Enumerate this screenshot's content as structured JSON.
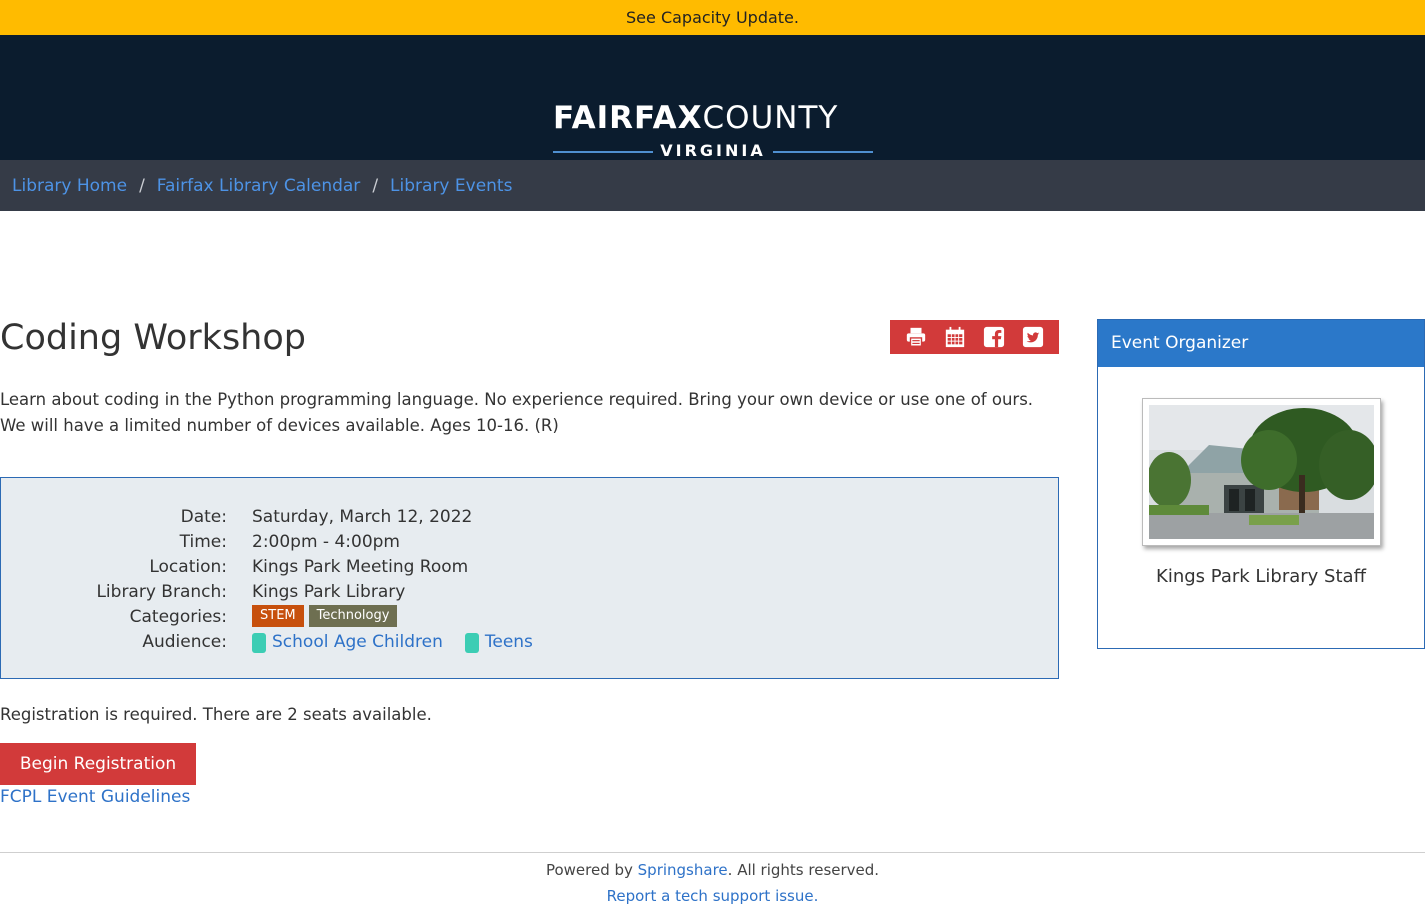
{
  "alert": {
    "text": "See Capacity Update."
  },
  "header": {
    "logo_bold": "FAIRFAX",
    "logo_light": "COUNTY",
    "logo_sub": "VIRGINIA"
  },
  "breadcrumb": {
    "items": [
      "Library Home",
      "Fairfax Library Calendar",
      "Library Events"
    ],
    "separator": "/"
  },
  "event": {
    "title": "Coding Workshop",
    "description": "Learn about coding in the Python programming language. No experience required. Bring your own device or use one of ours. We will have a limited number of devices available. Ages 10-16. (R)",
    "share_icons": [
      "print-icon",
      "calendar-icon",
      "facebook-icon",
      "twitter-icon"
    ],
    "details": {
      "date_label": "Date:",
      "date": "Saturday, March 12, 2022",
      "time_label": "Time:",
      "time": "2:00pm - 4:00pm",
      "location_label": "Location:",
      "location": "Kings Park Meeting Room",
      "branch_label": "Library Branch:",
      "branch": "Kings Park Library",
      "categories_label": "Categories:",
      "categories": [
        "STEM",
        "Technology"
      ],
      "audience_label": "Audience:",
      "audience": [
        "School Age Children",
        "Teens"
      ]
    },
    "registration_text": "Registration is required. There are 2 seats available.",
    "register_button": "Begin Registration",
    "guidelines_link": "FCPL Event Guidelines"
  },
  "organizer": {
    "heading": "Event Organizer",
    "name": "Kings Park Library Staff"
  },
  "footer": {
    "powered_prefix": "Powered by ",
    "powered_link": "Springshare",
    "powered_suffix": ". All rights reserved.",
    "report_link": "Report a tech support issue."
  },
  "colors": {
    "alert": "#ffbb00",
    "header": "#0b1c2e",
    "breadcrumb_bg": "#353b47",
    "accent_red": "#d23a3a",
    "link_blue": "#2e72c8",
    "organizer_blue": "#2b78c9",
    "tag_stem": "#c7500d",
    "tag_tech": "#6e6f51",
    "audience_dot": "#3ccdb4"
  }
}
